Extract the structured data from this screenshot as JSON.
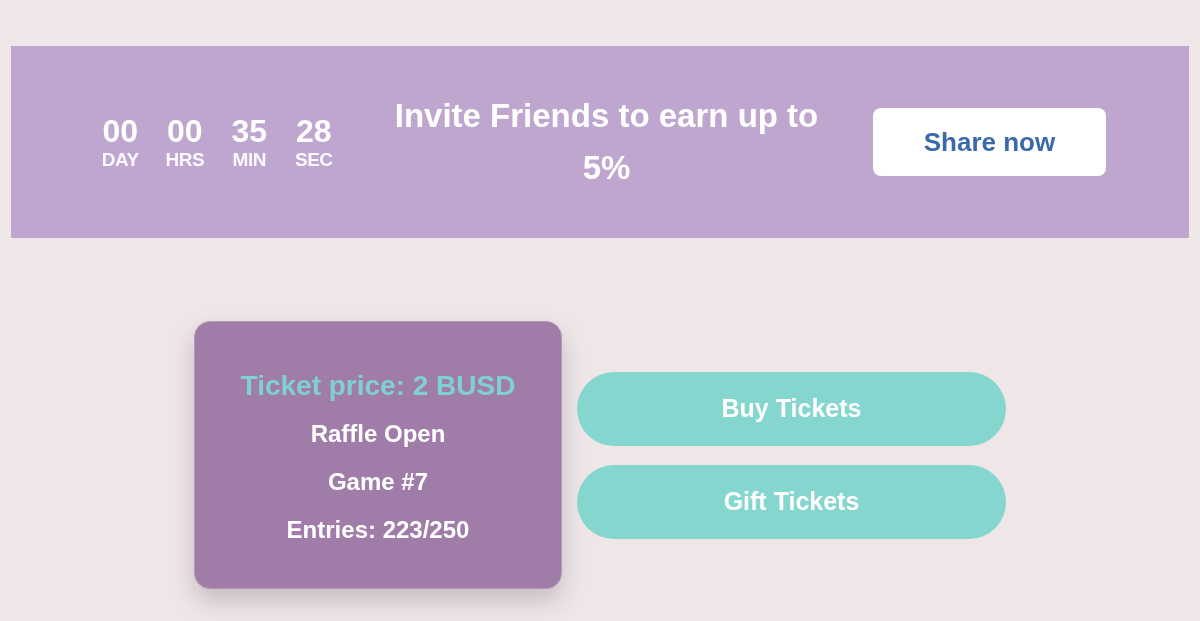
{
  "countdown": [
    {
      "value": "00",
      "unit": "DAY"
    },
    {
      "value": "00",
      "unit": "HRS"
    },
    {
      "value": "35",
      "unit": "MIN"
    },
    {
      "value": "28",
      "unit": "SEC"
    }
  ],
  "invite": {
    "text": "Invite Friends to earn up to 5%",
    "button": "Share now"
  },
  "raffle_card": {
    "price": "Ticket price: 2 BUSD",
    "status": "Raffle Open",
    "game": "Game #7",
    "entries": "Entries: 223/250"
  },
  "actions": [
    "Buy Tickets",
    "Gift Tickets"
  ]
}
